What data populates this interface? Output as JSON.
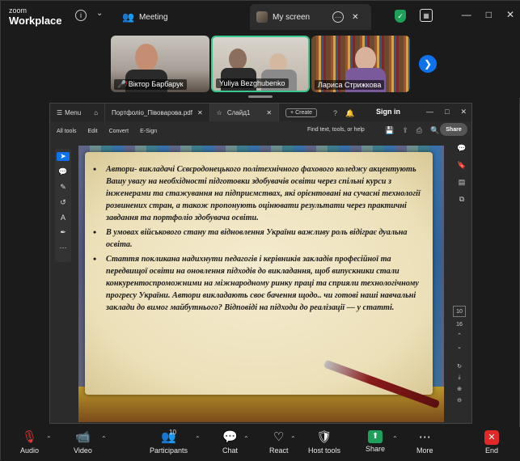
{
  "zoom": {
    "logo_line1": "zoom",
    "logo_line2": "Workplace",
    "tabs": [
      {
        "label": "Meeting"
      },
      {
        "label": "My screen"
      }
    ],
    "window_controls": [
      "—",
      "□",
      "✕"
    ]
  },
  "participants": [
    {
      "name": "Віктор Барбарук"
    },
    {
      "name": "Yuliya Bezghubenko"
    },
    {
      "name": "Лариса Стрижкова"
    }
  ],
  "acrobat": {
    "menu_label": "Menu",
    "tabs": [
      {
        "label": "Портфоліо_Півоварова.pdf"
      },
      {
        "label": "Слайд1"
      }
    ],
    "create_label": "+ Create",
    "sign_in": "Sign in",
    "toolbar": [
      "All tools",
      "Edit",
      "Convert",
      "E-Sign"
    ],
    "find_placeholder": "Find text, tools, or help",
    "share_label": "Share",
    "page_current": "10",
    "page_total": "16"
  },
  "slide": {
    "bullets": [
      "Автори- викладачі Сєвєродонецького політехнічного фахового коледжу акцентують Вашу увагу на необхідності підготовки здобувачів освіти через спільні курси з інженерами та стажування на підприємствах, які орієнтовані на сучасні технології розвинених стран, а також пропонують оцінювати результати через практичні завдання та портфоліо здобувача освіти.",
      "В умовах військового стану та відновлення України важливу роль відіграє дуальна освіта.",
      "Стаття покликана надихнути педагогів і керівників закладів професійної та передвищої освіти на оновлення підходів до викладання, щоб випускники стали конкурентоспроможними на міжнародному ринку праці та сприяли технологічному прогресу України. Автори викладають своє бачення щодо.. чи готові наші навчальні заклади до вимог майбутнього? Відповіді на підходи до реалізації — у статті."
    ]
  },
  "bottom_bar": {
    "audio": "Audio",
    "video": "Video",
    "participants": "Participants",
    "participants_count": "10",
    "chat": "Chat",
    "react": "React",
    "host_tools": "Host tools",
    "share": "Share",
    "more": "More",
    "end": "End"
  },
  "colors": {
    "accent": "#0e72ed",
    "active_tile": "#3ac78e",
    "end": "#e02828",
    "share": "#1fa05a"
  }
}
